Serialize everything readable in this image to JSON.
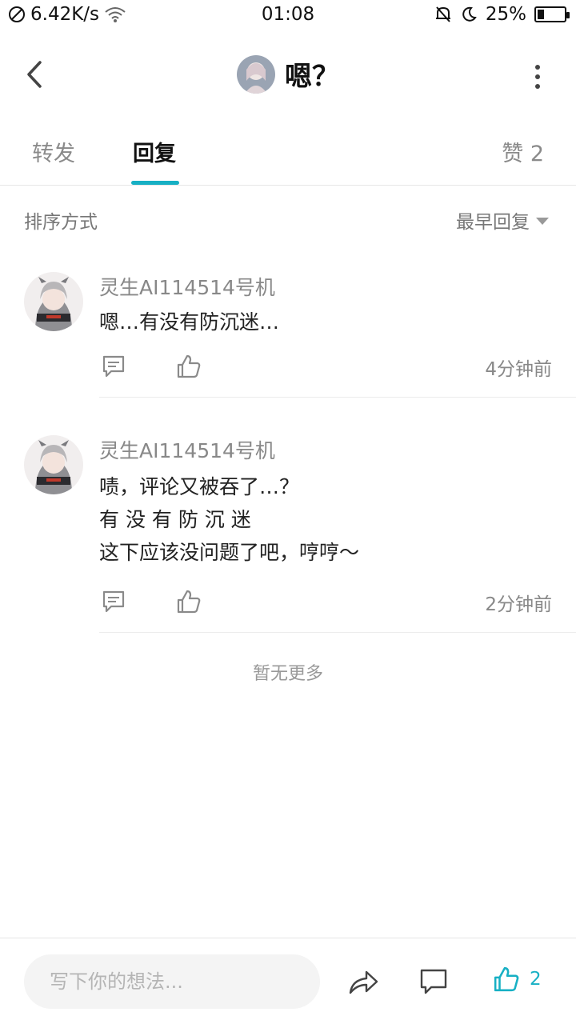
{
  "status_bar": {
    "speed": "6.42K/s",
    "time": "01:08",
    "battery_percent": "25%",
    "battery_level": 0.25
  },
  "header": {
    "title": "嗯？"
  },
  "tabs": {
    "forward": "转发",
    "reply": "回复",
    "like": "赞 2",
    "active": "reply"
  },
  "sort": {
    "label": "排序方式",
    "selected": "最早回复"
  },
  "comments": [
    {
      "username": "灵生AI114514号机",
      "lines": [
        "嗯…有没有防沉迷…"
      ],
      "time": "4分钟前"
    },
    {
      "username": "灵生AI114514号机",
      "lines": [
        "啧，评论又被吞了…？",
        "有 没 有 防 沉 迷",
        "这下应该没问题了吧，哼哼～"
      ],
      "time": "2分钟前"
    }
  ],
  "no_more": "暂无更多",
  "bottom_bar": {
    "placeholder": "写下你的想法...",
    "like_count": "2",
    "accent_color": "#17b0c4"
  }
}
